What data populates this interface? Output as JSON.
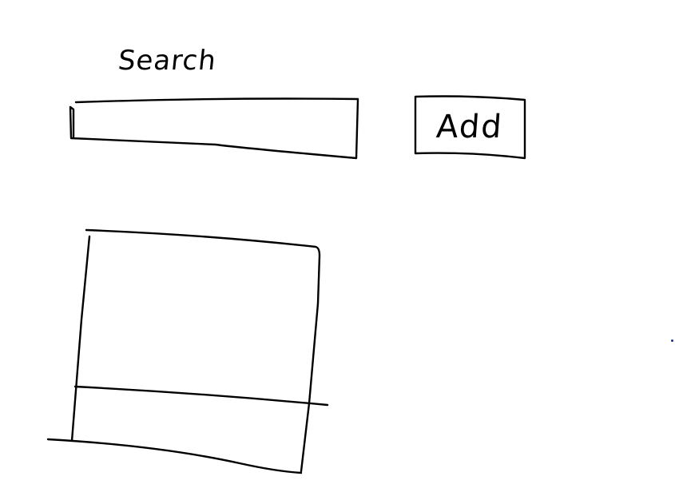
{
  "search": {
    "label": "Search",
    "value": ""
  },
  "add_button": {
    "label": "Add"
  },
  "colors": {
    "ink": "#000000",
    "background": "#ffffff"
  }
}
